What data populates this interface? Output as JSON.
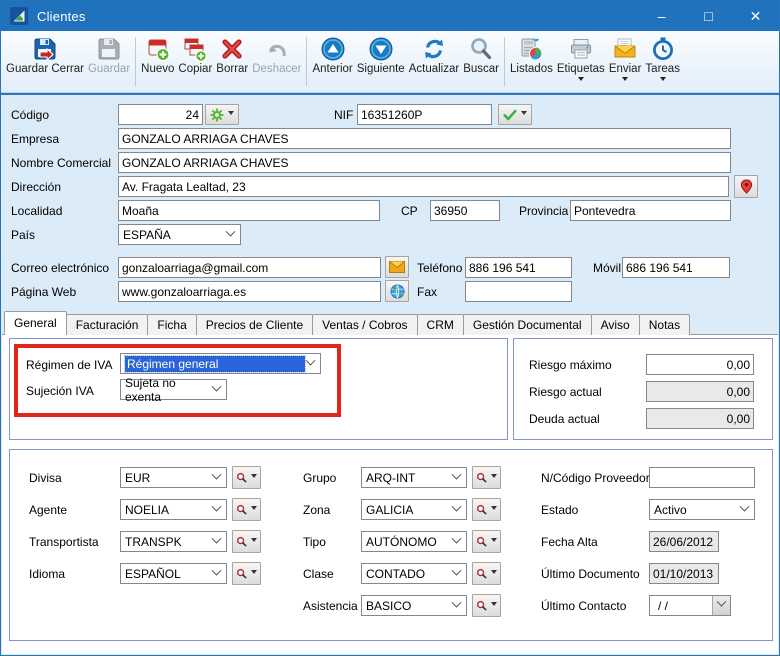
{
  "window": {
    "title": "Clientes",
    "controls": {
      "minimize": "–",
      "maximize": "□",
      "close": "✕"
    }
  },
  "colors": {
    "titlebar_blue": "#2172bd",
    "selection_blue": "#2a64d8",
    "annotation_red": "#e1251b",
    "groupbox_border": "#8194cf",
    "form_background": "#dcebf8"
  },
  "toolbar": {
    "items": [
      {
        "label": "Guardar Cerrar",
        "icon": "save-close-icon",
        "enabled": true,
        "dropdown": false
      },
      {
        "label": "Guardar",
        "icon": "save-icon",
        "enabled": false,
        "dropdown": false
      },
      {
        "label": "Nuevo",
        "icon": "new-record-icon",
        "enabled": true,
        "dropdown": false
      },
      {
        "label": "Copiar",
        "icon": "copy-icon",
        "enabled": true,
        "dropdown": false
      },
      {
        "label": "Borrar",
        "icon": "delete-icon",
        "enabled": true,
        "dropdown": false
      },
      {
        "label": "Deshacer",
        "icon": "undo-icon",
        "enabled": false,
        "dropdown": false
      },
      {
        "label": "Anterior",
        "icon": "previous-icon",
        "enabled": true,
        "dropdown": false
      },
      {
        "label": "Siguiente",
        "icon": "next-icon",
        "enabled": true,
        "dropdown": false
      },
      {
        "label": "Actualizar",
        "icon": "refresh-icon",
        "enabled": true,
        "dropdown": false
      },
      {
        "label": "Buscar",
        "icon": "search-icon",
        "enabled": true,
        "dropdown": false
      },
      {
        "label": "Listados",
        "icon": "reports-icon",
        "enabled": true,
        "dropdown": false
      },
      {
        "label": "Etiquetas",
        "icon": "printer-icon",
        "enabled": true,
        "dropdown": true
      },
      {
        "label": "Enviar",
        "icon": "send-mail-icon",
        "enabled": true,
        "dropdown": true
      },
      {
        "label": "Tareas",
        "icon": "tasks-clock-icon",
        "enabled": true,
        "dropdown": true
      }
    ]
  },
  "form": {
    "codigo": {
      "label": "Código",
      "value": "24"
    },
    "nif": {
      "label": "NIF",
      "value": "16351260P"
    },
    "empresa": {
      "label": "Empresa",
      "value": "GONZALO ARRIAGA CHAVES"
    },
    "nombre_comercial": {
      "label": "Nombre Comercial",
      "value": "GONZALO ARRIAGA CHAVES"
    },
    "direccion": {
      "label": "Dirección",
      "value": "Av. Fragata Lealtad, 23"
    },
    "localidad": {
      "label": "Localidad",
      "value": "Moaña"
    },
    "cp": {
      "label": "CP",
      "value": "36950"
    },
    "provincia": {
      "label": "Provincia",
      "value": "Pontevedra"
    },
    "pais": {
      "label": "País",
      "value": "ESPAÑA"
    },
    "correo": {
      "label": "Correo electrónico",
      "value": "gonzaloarriaga@gmail.com"
    },
    "telefono": {
      "label": "Teléfono",
      "value": "886 196 541"
    },
    "movil": {
      "label": "Móvil",
      "value": "686 196 541"
    },
    "pagina_web": {
      "label": "Página Web",
      "value": "www.gonzaloarriaga.es"
    },
    "fax": {
      "label": "Fax",
      "value": ""
    }
  },
  "tabs": [
    {
      "label": "General",
      "active": true
    },
    {
      "label": "Facturación",
      "active": false
    },
    {
      "label": "Ficha",
      "active": false
    },
    {
      "label": "Precios de Cliente",
      "active": false
    },
    {
      "label": "Ventas / Cobros",
      "active": false
    },
    {
      "label": "CRM",
      "active": false
    },
    {
      "label": "Gestión Documental",
      "active": false
    },
    {
      "label": "Aviso",
      "active": false
    },
    {
      "label": "Notas",
      "active": false
    }
  ],
  "general_tab": {
    "iva": {
      "regimen": {
        "label": "Régimen de IVA",
        "value": "Régimen general",
        "selected": true
      },
      "sujecion": {
        "label": "Sujeción IVA",
        "value": "Sujeta no exenta"
      }
    },
    "riesgo": {
      "maximo": {
        "label": "Riesgo máximo",
        "value": "0,00",
        "readonly": false
      },
      "actual": {
        "label": "Riesgo actual",
        "value": "0,00",
        "readonly": true
      },
      "deuda": {
        "label": "Deuda actual",
        "value": "0,00",
        "readonly": true
      }
    },
    "clasificacion": {
      "divisa": {
        "label": "Divisa",
        "value": "EUR"
      },
      "agente": {
        "label": "Agente",
        "value": "NOELIA"
      },
      "transportista": {
        "label": "Transportista",
        "value": "TRANSPK"
      },
      "idioma": {
        "label": "Idioma",
        "value": "ESPAÑOL"
      },
      "grupo": {
        "label": "Grupo",
        "value": "ARQ-INT"
      },
      "zona": {
        "label": "Zona",
        "value": "GALICIA"
      },
      "tipo": {
        "label": "Tipo",
        "value": "AUTÓNOMO"
      },
      "clase": {
        "label": "Clase",
        "value": "CONTADO"
      },
      "asistencia": {
        "label": "Asistencia",
        "value": "BASICO"
      },
      "codigo_proveedor": {
        "label": "N/Código Proveedor",
        "value": ""
      },
      "estado": {
        "label": "Estado",
        "value": "Activo"
      },
      "fecha_alta": {
        "label": "Fecha Alta",
        "value": "26/06/2012"
      },
      "ultimo_documento": {
        "label": "Último Documento",
        "value": "01/10/2013"
      },
      "ultimo_contacto": {
        "label": "Último Contacto",
        "value": "/  /"
      }
    }
  }
}
